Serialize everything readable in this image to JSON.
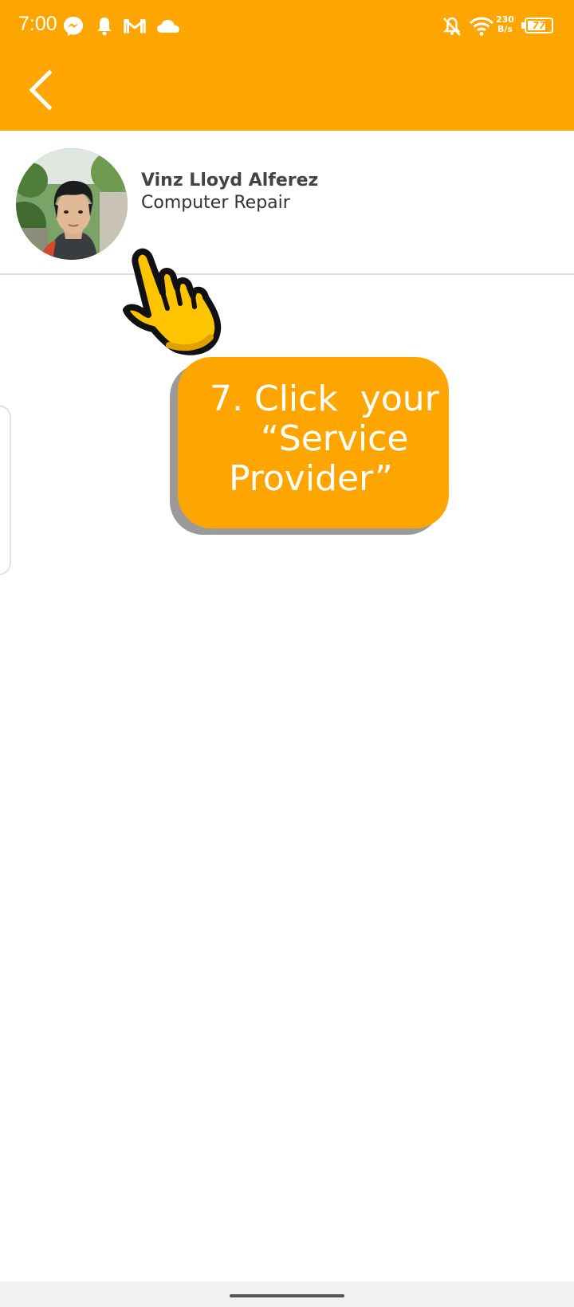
{
  "status_bar": {
    "time": "7:00",
    "net_speed_value": "230",
    "net_speed_unit": "B/s",
    "battery": "77",
    "battery_level": 0.77,
    "icons": [
      "messenger-icon",
      "notification-bell-icon",
      "gmail-icon",
      "cloud-icon",
      "bell-off-icon",
      "wifi-icon",
      "battery-icon"
    ]
  },
  "app_bar": {
    "color": "#FFA500",
    "back_icon": "chevron-left-icon"
  },
  "provider": {
    "name": "Vinz Lloyd Alferez",
    "service": "Computer Repair"
  },
  "tutorial": {
    "line1": "7. Click  your",
    "line2": "“Service",
    "line3": "Provider”",
    "pointer_icon": "pointing-hand-icon"
  }
}
